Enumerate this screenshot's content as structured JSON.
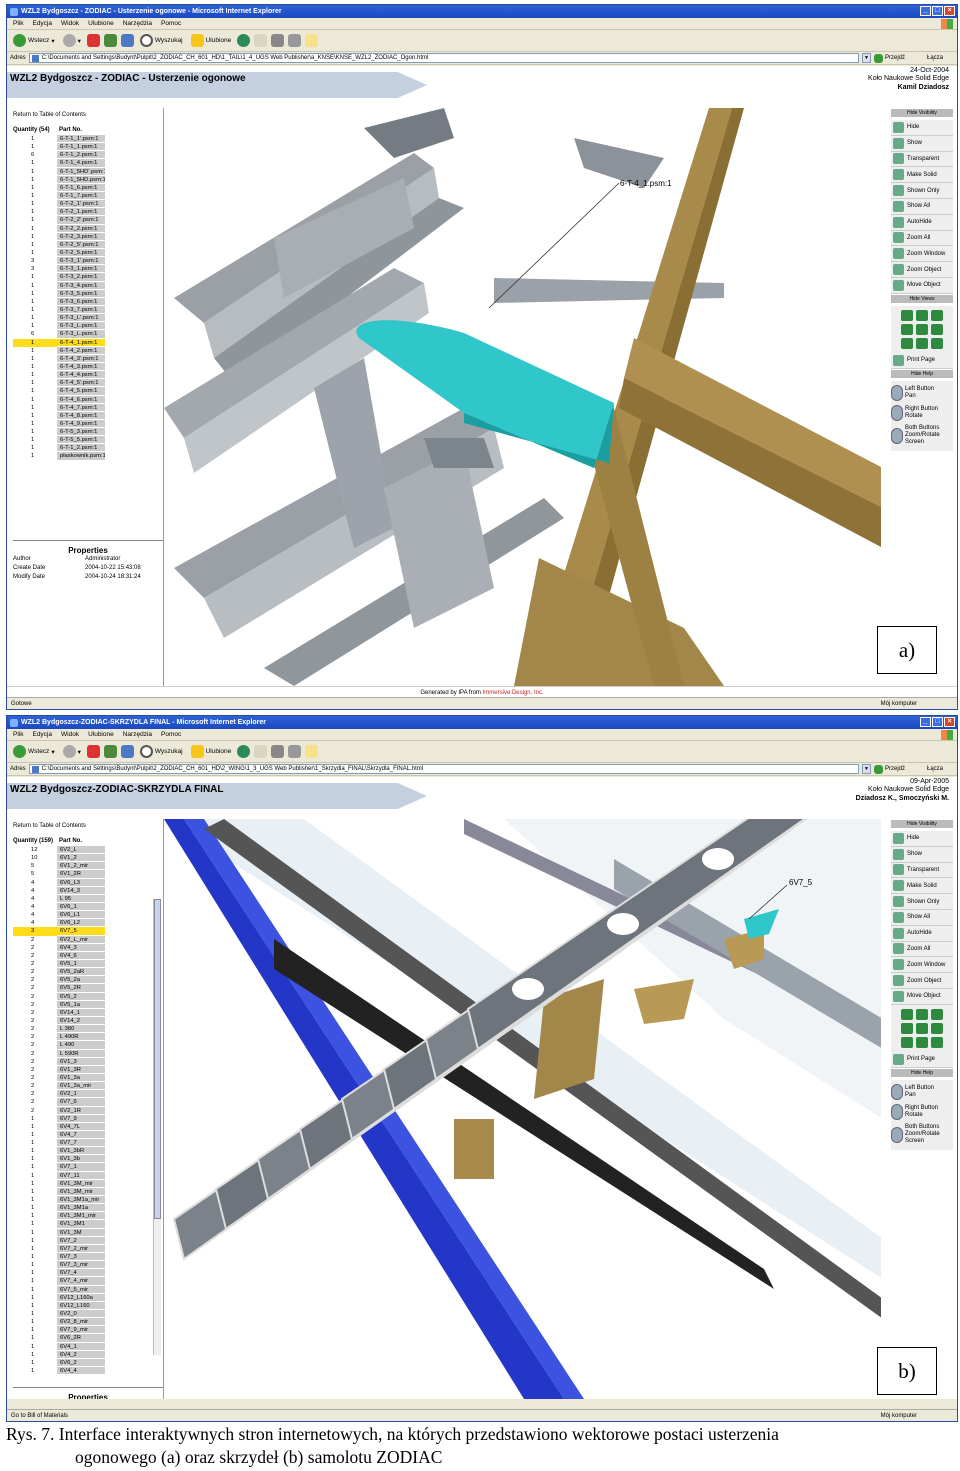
{
  "window_a": {
    "title": "WZL2 Bydgoszcz - ZODIAC - Usterzenie ogonowe - Microsoft Internet Explorer",
    "menu": [
      "Plik",
      "Edycja",
      "Widok",
      "Ulubione",
      "Narzędzia",
      "Pomoc"
    ],
    "toolbar": {
      "back": "Wstecz",
      "search": "Wyszukaj",
      "favorites": "Ulubione"
    },
    "address_label": "Adres",
    "address": "C:\\Documents and Settings\\Budynt\\Pulpit\\2_ZODIAC_CH_601_HD\\1_TAIL\\1_4_UGS Web Publisher\\a_KNSE\\KNSE_WZL2_ZODIAC_Ogon.html",
    "go_label": "Przejdź",
    "links_label": "Łącza",
    "page_title": "WZL2 Bydgoszcz - ZODIAC - Usterzenie ogonowe",
    "info": {
      "date": "24-Oct-2004",
      "org": "Koło Naukowe Solid Edge",
      "author": "Kamil Dziadosz"
    },
    "return_link": "Return to Table of Contents",
    "table_headers": {
      "qty": "Quantity (54)",
      "part": "Part No."
    },
    "parts": [
      [
        "1",
        "6-T-1_1'.psm:1"
      ],
      [
        "1",
        "6-T-1_1.psm:1"
      ],
      [
        "6",
        "6-T-1_2.psm:1"
      ],
      [
        "1",
        "6-T-1_4.psm:1"
      ],
      [
        "1",
        "6-T-1_5HD'.psm:1"
      ],
      [
        "1",
        "6-T-1_5HD.psm:1"
      ],
      [
        "1",
        "6-T-1_6.psm:1"
      ],
      [
        "1",
        "6-T-1_7.psm:1"
      ],
      [
        "1",
        "6-T-2_1'.psm:1"
      ],
      [
        "1",
        "6-T-2_1.psm:1"
      ],
      [
        "1",
        "6-T-2_2'.psm:1"
      ],
      [
        "1",
        "6-T-2_2.psm:1"
      ],
      [
        "1",
        "6-T-2_3.psm:1"
      ],
      [
        "1",
        "6-T-2_5'.psm:1"
      ],
      [
        "1",
        "6-T-2_5.psm:1"
      ],
      [
        "3",
        "6-T-3_1'.psm:1"
      ],
      [
        "3",
        "6-T-3_1.psm:1"
      ],
      [
        "1",
        "6-T-3_2.psm:1"
      ],
      [
        "1",
        "6-T-3_4.psm:1"
      ],
      [
        "1",
        "6-T-3_5.psm:1"
      ],
      [
        "1",
        "6-T-3_6.psm:1"
      ],
      [
        "1",
        "6-T-3_7.psm:1"
      ],
      [
        "1",
        "6-T-3_L'.psm:1"
      ],
      [
        "1",
        "6-T-3_L.psm:1"
      ],
      [
        "6",
        "6-T-3_L.psm:1"
      ],
      [
        "1",
        "6-T-4_1.psm:1"
      ],
      [
        "1",
        "6-T-4_2.psm:1"
      ],
      [
        "1",
        "6-T-4_3'.psm:1"
      ],
      [
        "1",
        "6-T-4_3.psm:1"
      ],
      [
        "1",
        "6-T-4_4.psm:1"
      ],
      [
        "1",
        "6-T-4_5'.psm:1"
      ],
      [
        "1",
        "6-T-4_5.psm:1"
      ],
      [
        "1",
        "6-T-4_6.psm:1"
      ],
      [
        "1",
        "6-T-4_7.psm:1"
      ],
      [
        "1",
        "6-T-4_8.psm:1"
      ],
      [
        "1",
        "6-T-4_9.psm:1"
      ],
      [
        "1",
        "6-T-5_3.psm:1"
      ],
      [
        "1",
        "6-T-5_5.psm:1"
      ],
      [
        "1",
        "6-T-1_2.psm:1"
      ],
      [
        "1",
        "płaskownik.psm:1"
      ]
    ],
    "selected_part": "6-T-4_1.psm:1",
    "callout": "6-T-4_1.psm:1",
    "properties": {
      "title": "Properties",
      "rows": [
        [
          "Author",
          "Administrator"
        ],
        [
          "Create Date",
          "2004-10-22 15:43:08"
        ],
        [
          "Modify Date",
          "2004-10-24 18:31:24"
        ]
      ]
    },
    "footer": {
      "prefix": "Generated by IPA from ",
      "company": "Immersive Design, Inc."
    },
    "status_left": "Gotowe",
    "status_right": "Mój komputer",
    "label": "a)"
  },
  "window_b": {
    "title": "WZL2 Bydgoszcz-ZODIAC-SKRZYDLA FINAL - Microsoft Internet Explorer",
    "menu": [
      "Plik",
      "Edycja",
      "Widok",
      "Ulubione",
      "Narzędzia",
      "Pomoc"
    ],
    "toolbar": {
      "back": "Wstecz",
      "search": "Wyszukaj",
      "favorites": "Ulubione"
    },
    "address_label": "Adres",
    "address": "C:\\Documents and Settings\\Budynt\\Pulpit\\2_ZODIAC_CH_601_HD\\2_WING\\1_3_UGS Web Publisher\\1_Skrzydla_FINAL\\Skrzydla_FINAL.html",
    "go_label": "Przejdź",
    "links_label": "Łącza",
    "page_title": "WZL2 Bydgoszcz-ZODIAC-SKRZYDLA FINAL",
    "info": {
      "date": "09-Apr-2005",
      "org": "Koło Naukowe Solid Edge",
      "author": "Dziadosz K., Smoczyński M."
    },
    "return_link": "Return to Table of Contents",
    "table_headers": {
      "qty": "Quantity (159)",
      "part": "Part No."
    },
    "parts": [
      [
        "12",
        "6V2_L"
      ],
      [
        "10",
        "6V1_2"
      ],
      [
        "5",
        "6V1_2_mir"
      ],
      [
        "5",
        "6V1_2R"
      ],
      [
        "4",
        "6V6_L3"
      ],
      [
        "4",
        "6V14_3"
      ],
      [
        "4",
        "L 95"
      ],
      [
        "4",
        "6V6_1"
      ],
      [
        "4",
        "6V6_L1"
      ],
      [
        "4",
        "6V6_L2"
      ],
      [
        "3",
        "6V7_5"
      ],
      [
        "2",
        "6V2_L_mir"
      ],
      [
        "2",
        "6V4_3"
      ],
      [
        "2",
        "6V4_6"
      ],
      [
        "2",
        "6V5_1"
      ],
      [
        "2",
        "6V5_2aR"
      ],
      [
        "2",
        "6V5_2a"
      ],
      [
        "2",
        "6V5_2R"
      ],
      [
        "2",
        "6V5_2"
      ],
      [
        "2",
        "6V5_1a"
      ],
      [
        "2",
        "6V14_1"
      ],
      [
        "2",
        "6V14_2"
      ],
      [
        "2",
        "L 380"
      ],
      [
        "2",
        "L 490R"
      ],
      [
        "2",
        "L 490"
      ],
      [
        "2",
        "L 590R"
      ],
      [
        "2",
        "6V1_3"
      ],
      [
        "2",
        "6V1_3R"
      ],
      [
        "2",
        "6V1_3a"
      ],
      [
        "2",
        "6V1_3a_mir"
      ],
      [
        "2",
        "6V2_1"
      ],
      [
        "2",
        "6V7_6"
      ],
      [
        "2",
        "6V2_1R"
      ],
      [
        "1",
        "6V7_9"
      ],
      [
        "1",
        "6V4_7L"
      ],
      [
        "1",
        "6V4_7"
      ],
      [
        "1",
        "6V7_7"
      ],
      [
        "1",
        "6V1_3bR"
      ],
      [
        "1",
        "6V1_3b"
      ],
      [
        "1",
        "6V7_1"
      ],
      [
        "1",
        "6V7_11"
      ],
      [
        "1",
        "6V1_3M_mir"
      ],
      [
        "1",
        "6V1_3M_mir"
      ],
      [
        "1",
        "6V1_3M1a_mir"
      ],
      [
        "1",
        "6V1_3M1a"
      ],
      [
        "1",
        "6V1_3M1_mir"
      ],
      [
        "1",
        "6V1_3M1"
      ],
      [
        "1",
        "6V1_3M"
      ],
      [
        "1",
        "6V7_2"
      ],
      [
        "1",
        "6V7_2_mir"
      ],
      [
        "1",
        "6V7_3"
      ],
      [
        "1",
        "6V7_3_mir"
      ],
      [
        "1",
        "6V7_4"
      ],
      [
        "1",
        "6V7_4_mir"
      ],
      [
        "1",
        "6V7_5_mir"
      ],
      [
        "1",
        "6V12_L160a"
      ],
      [
        "1",
        "6V12_L160"
      ],
      [
        "1",
        "6V2_0"
      ],
      [
        "1",
        "6V2_8_mir"
      ],
      [
        "1",
        "6V7_9_mir"
      ],
      [
        "1",
        "6V6_2R"
      ],
      [
        "1",
        "6V4_1"
      ],
      [
        "1",
        "6V4_2"
      ],
      [
        "1",
        "6V6_2"
      ],
      [
        "1",
        "6V4_4"
      ]
    ],
    "selected_part": "6V7_5",
    "callout": "6V7_5",
    "properties": {
      "title": "Properties"
    },
    "footer_link": "Go to Bill of Materials",
    "status_right": "Mój komputer",
    "label": "b)"
  },
  "right_panel": {
    "visibility_header": "Hide Visibility",
    "buttons": [
      "Hide",
      "Show",
      "Transparent",
      "Make Solid",
      "Shown Only",
      "Show All",
      "AutoHide",
      "Zoom All",
      "Zoom Window",
      "Zoom Object",
      "Move Object"
    ],
    "views_header": "Hide Views",
    "print": "Print Page",
    "help_header": "Hide Help",
    "help": [
      [
        "Left Button",
        "Pan"
      ],
      [
        "Right Button",
        "Rotate"
      ],
      [
        "Both Buttons",
        "Zoom/Rotate",
        "Screen"
      ]
    ]
  },
  "caption": {
    "line1": "Rys. 7. Interface interaktywnych stron internetowych, na których przedstawiono wektorowe postaci usterzenia",
    "line2": "ogonowego (a) oraz skrzydeł (b) samolotu ZODIAC"
  }
}
